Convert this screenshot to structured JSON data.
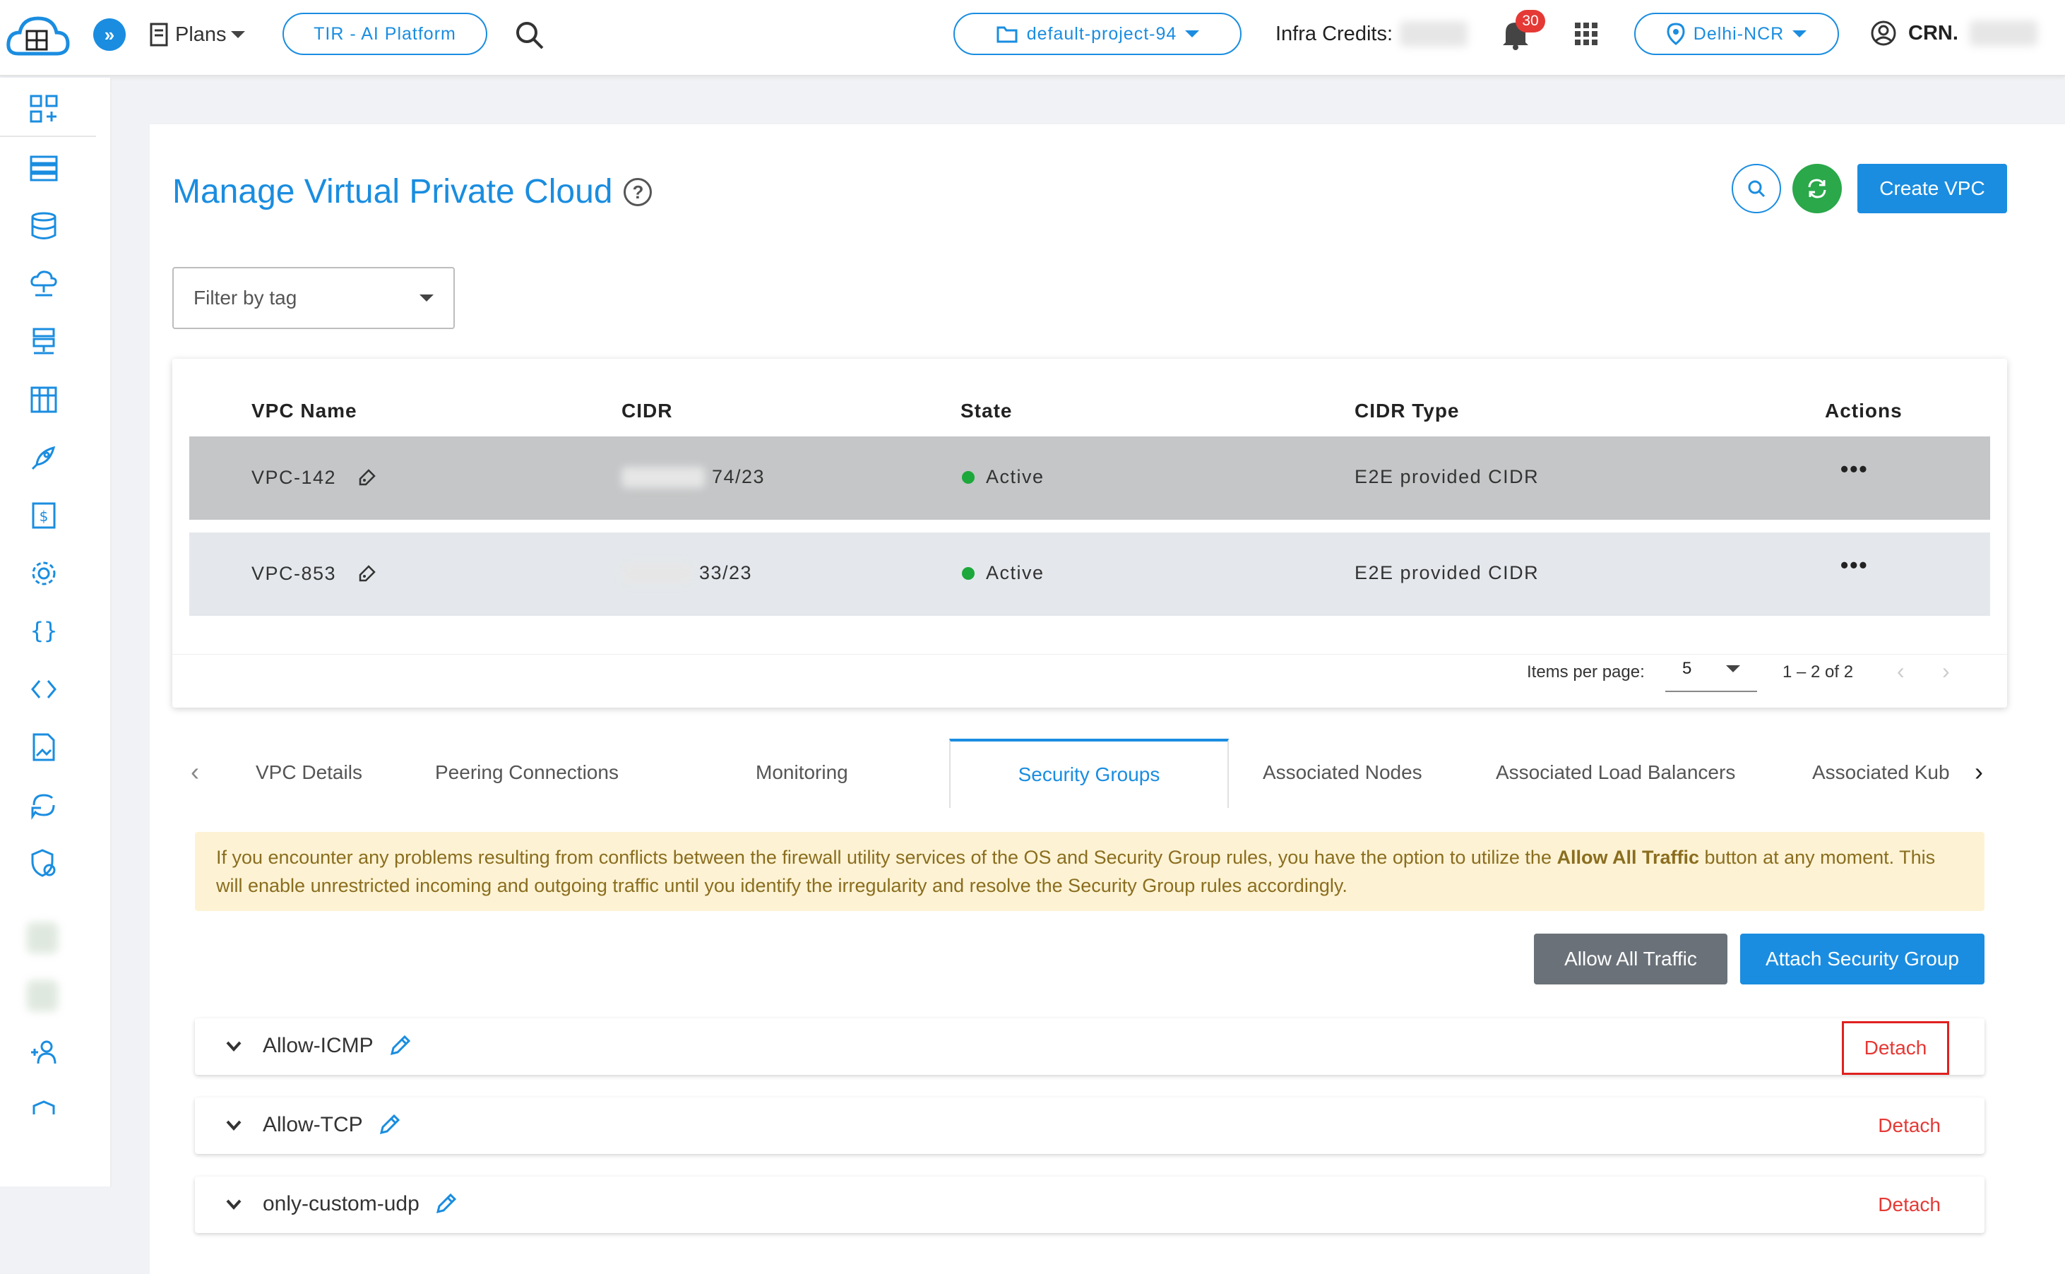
{
  "topbar": {
    "plans_label": "Plans",
    "tir_label": "TIR - AI Platform",
    "project_label": "default-project-94",
    "credits_label": "Infra Credits:",
    "notifications_count": "30",
    "region_label": "Delhi-NCR",
    "crn_label": "CRN."
  },
  "page": {
    "title": "Manage Virtual Private Cloud",
    "create_button": "Create VPC",
    "filter_placeholder": "Filter by tag"
  },
  "table": {
    "headers": [
      "VPC Name",
      "CIDR",
      "State",
      "CIDR Type",
      "Actions"
    ],
    "rows": [
      {
        "name": "VPC-142",
        "cidr_suffix": "74/23",
        "state": "Active",
        "cidr_type": "E2E provided CIDR",
        "actions": "•••"
      },
      {
        "name": "VPC-853",
        "cidr_suffix": "33/23",
        "state": "Active",
        "cidr_type": "E2E provided CIDR",
        "actions": "•••"
      }
    ],
    "pager": {
      "items_label": "Items per page:",
      "page_size": "5",
      "range": "1 – 2 of 2"
    }
  },
  "tabs": [
    "VPC Details",
    "Peering Connections",
    "Monitoring",
    "Security Groups",
    "Associated Nodes",
    "Associated Load Balancers",
    "Associated Kub"
  ],
  "active_tab": "Security Groups",
  "warning": {
    "text_before": "If you encounter any problems resulting from conflicts between the firewall utility services of the OS and Security Group rules, you have the option to utilize the ",
    "bold": "Allow All Traffic",
    "text_after": " button at any moment. This will enable unrestricted incoming and outgoing traffic until you identify the irregularity and resolve the Security Group rules accordingly."
  },
  "buttons": {
    "allow_all": "Allow All Traffic",
    "attach": "Attach Security Group"
  },
  "security_groups": [
    {
      "name": "Allow-ICMP",
      "action": "Detach"
    },
    {
      "name": "Allow-TCP",
      "action": "Detach"
    },
    {
      "name": "only-custom-udp",
      "action": "Detach"
    }
  ],
  "colors": {
    "accent": "#1a8de0",
    "active_green": "#1ca83a",
    "danger": "#e53935",
    "warning_bg": "#fdf3d4"
  }
}
